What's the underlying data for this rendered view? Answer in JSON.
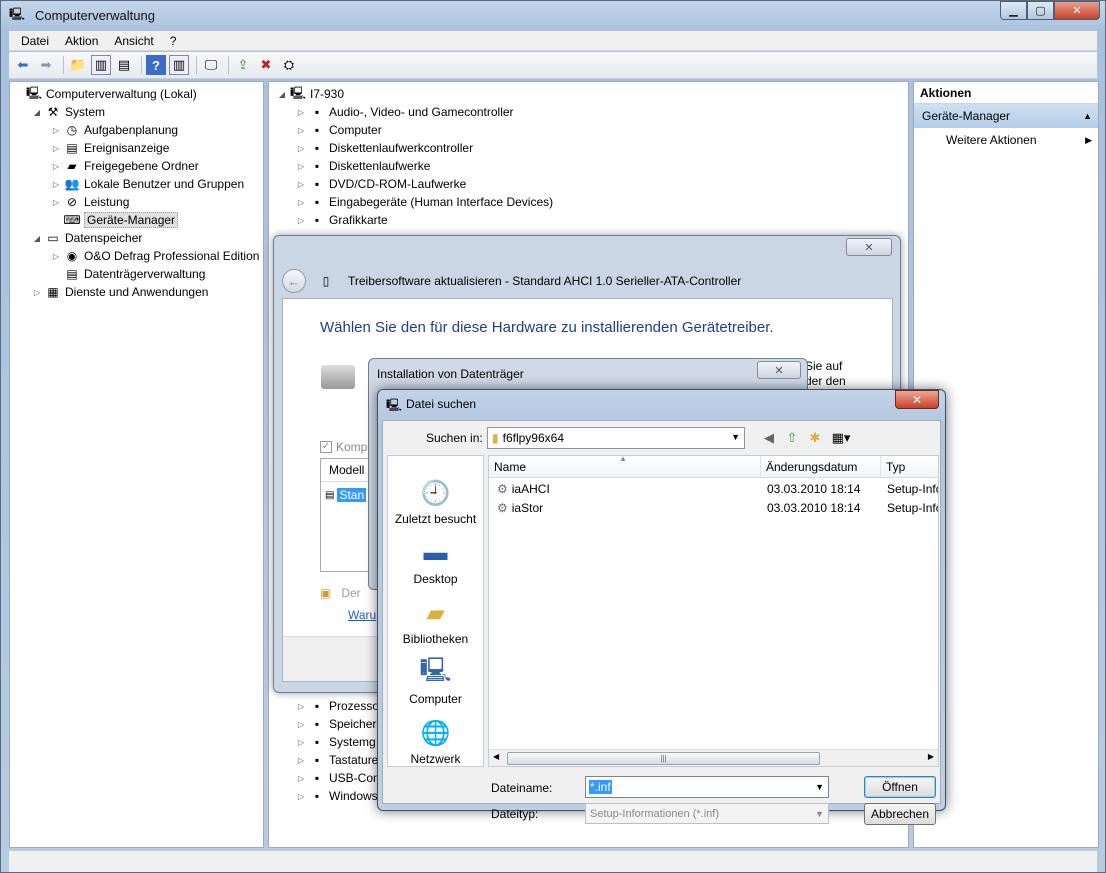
{
  "window": {
    "title": "Computerverwaltung"
  },
  "menu": [
    "Datei",
    "Aktion",
    "Ansicht",
    "?"
  ],
  "left_tree": [
    {
      "label": "Computerverwaltung (Lokal)",
      "level": 0,
      "arrow": "",
      "icon": "computer-management-icon"
    },
    {
      "label": "System",
      "level": 1,
      "arrow": "◢",
      "icon": "system-tools-icon"
    },
    {
      "label": "Aufgabenplanung",
      "level": 2,
      "arrow": "▷",
      "icon": "clock-icon"
    },
    {
      "label": "Ereignisanzeige",
      "level": 2,
      "arrow": "▷",
      "icon": "event-viewer-icon"
    },
    {
      "label": "Freigegebene Ordner",
      "level": 2,
      "arrow": "▷",
      "icon": "shared-folder-icon"
    },
    {
      "label": "Lokale Benutzer und Gruppen",
      "level": 2,
      "arrow": "▷",
      "icon": "users-icon"
    },
    {
      "label": "Leistung",
      "level": 2,
      "arrow": "▷",
      "icon": "performance-icon"
    },
    {
      "label": "Geräte-Manager",
      "level": 2,
      "arrow": "",
      "icon": "device-manager-icon",
      "selected": true
    },
    {
      "label": "Datenspeicher",
      "level": 1,
      "arrow": "◢",
      "icon": "storage-icon"
    },
    {
      "label": "O&O Defrag Professional Edition",
      "level": 2,
      "arrow": "▷",
      "icon": "defrag-icon"
    },
    {
      "label": "Datenträgerverwaltung",
      "level": 2,
      "arrow": "",
      "icon": "disk-management-icon"
    },
    {
      "label": "Dienste und Anwendungen",
      "level": 1,
      "arrow": "▷",
      "icon": "services-icon"
    }
  ],
  "center_tree": [
    {
      "label": "I7-930",
      "arrow": "◢",
      "level": 0
    },
    {
      "label": "Audio-, Video- und Gamecontroller",
      "arrow": "▷",
      "level": 1
    },
    {
      "label": "Computer",
      "arrow": "▷",
      "level": 1
    },
    {
      "label": "Diskettenlaufwerkcontroller",
      "arrow": "▷",
      "level": 1
    },
    {
      "label": "Diskettenlaufwerke",
      "arrow": "▷",
      "level": 1
    },
    {
      "label": "DVD/CD-ROM-Laufwerke",
      "arrow": "▷",
      "level": 1
    },
    {
      "label": "Eingabegeräte (Human Interface Devices)",
      "arrow": "▷",
      "level": 1
    },
    {
      "label": "Grafikkarte",
      "arrow": "▷",
      "level": 1
    }
  ],
  "center_tree_bottom": [
    {
      "label": "Prozesso",
      "arrow": "▷"
    },
    {
      "label": "Speicher",
      "arrow": "▷"
    },
    {
      "label": "Systemg",
      "arrow": "▷"
    },
    {
      "label": "Tastature",
      "arrow": "▷"
    },
    {
      "label": "USB-Con",
      "arrow": "▷"
    },
    {
      "label": "Windows",
      "arrow": "▷"
    }
  ],
  "actions": {
    "header": "Aktionen",
    "section": "Geräte-Manager",
    "item": "Weitere Aktionen"
  },
  "driver_dialog": {
    "title": "Treibersoftware aktualisieren - Standard AHCI 1.0 Serieller-ATA-Controller",
    "heading": "Wählen Sie den für diese Hardware zu installierenden Gerätetreiber.",
    "partial_right_1": "Sie auf",
    "partial_right_2": "der den",
    "checkbox_label": "Komp",
    "model_header": "Modell",
    "model_item": "Stan",
    "footer_text": "Der",
    "link": "Waru"
  },
  "install_dialog": {
    "title": "Installation von Datenträger"
  },
  "file_dialog": {
    "title": "Datei suchen",
    "lookin_label": "Suchen in:",
    "lookin_value": "f6flpy96x64",
    "places": [
      "Zuletzt besucht",
      "Desktop",
      "Bibliotheken",
      "Computer",
      "Netzwerk"
    ],
    "columns": [
      "Name",
      "Änderungsdatum",
      "Typ"
    ],
    "files": [
      {
        "name": "iaAHCI",
        "date": "03.03.2010 18:14",
        "type": "Setup-Info"
      },
      {
        "name": "iaStor",
        "date": "03.03.2010 18:14",
        "type": "Setup-Info"
      }
    ],
    "filename_label": "Dateiname:",
    "filename_value": "*.inf",
    "filetype_label": "Dateityp:",
    "filetype_value": "Setup-Informationen (*.inf)",
    "open_button": "Öffnen",
    "cancel_button": "Abbrechen"
  }
}
